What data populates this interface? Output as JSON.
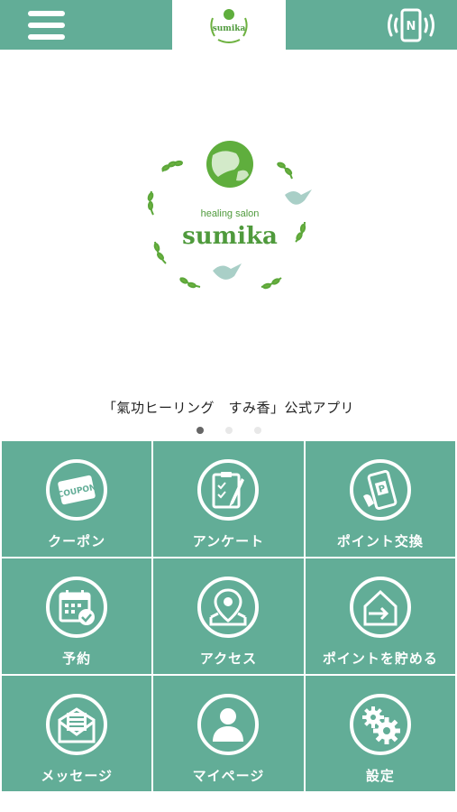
{
  "header": {
    "logo_small_text": "sumika",
    "menu_icon": "hamburger-menu-icon",
    "nfc_icon": "nfc-phone-icon"
  },
  "hero": {
    "logo_subtitle": "healing salon",
    "logo_title": "sumika",
    "caption": "「氣功ヒーリング　すみ香」公式アプリ",
    "slides": 3,
    "active_slide": 1
  },
  "menu": [
    {
      "id": "coupon",
      "label": "クーポン",
      "icon": "coupon-icon",
      "icon_text": "COUPON"
    },
    {
      "id": "survey",
      "label": "アンケート",
      "icon": "clipboard-icon"
    },
    {
      "id": "point-exchange",
      "label": "ポイント交換",
      "icon": "phone-point-icon",
      "icon_text": "P"
    },
    {
      "id": "reservation",
      "label": "予約",
      "icon": "calendar-check-icon"
    },
    {
      "id": "access",
      "label": "アクセス",
      "icon": "map-pin-icon"
    },
    {
      "id": "save-points",
      "label": "ポイントを貯める",
      "icon": "house-enter-icon"
    },
    {
      "id": "message",
      "label": "メッセージ",
      "icon": "envelope-icon"
    },
    {
      "id": "mypage",
      "label": "マイページ",
      "icon": "user-icon"
    },
    {
      "id": "settings",
      "label": "設定",
      "icon": "gears-icon"
    }
  ],
  "colors": {
    "accent": "#62ad97",
    "logo_green": "#4f9a3c"
  }
}
